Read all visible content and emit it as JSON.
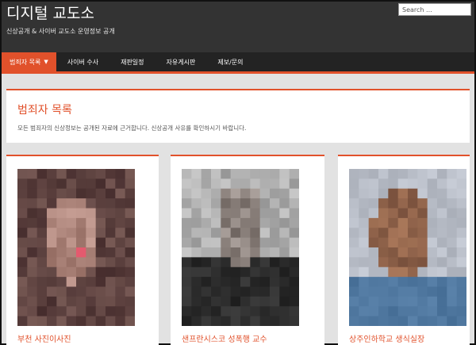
{
  "site": {
    "title": "디지털 교도소",
    "tagline": "신상공개 & 사이버 교도소 운영정보 공개",
    "search_placeholder": "Search ..."
  },
  "nav": {
    "items": [
      {
        "label": "범죄자 목록",
        "active": true,
        "has_dropdown": true
      },
      {
        "label": "사이버 수사",
        "active": false
      },
      {
        "label": "재판일정",
        "active": false
      },
      {
        "label": "자유게시판",
        "active": false
      },
      {
        "label": "제보/문의",
        "active": false
      }
    ]
  },
  "intro": {
    "title": "범죄자 목록",
    "description": "모든 범죄자의 신상정보는 공개된 자료에 근거합니다. 신상공개 사유를 확인하시기 바랍니다."
  },
  "cards": [
    {
      "name": "부천 사진이사진",
      "photo_description": "pixelated"
    },
    {
      "name": "샌프란시스코 성폭행 교수",
      "photo_description": "pixelated"
    },
    {
      "name": "상주인하학교 생식실장",
      "photo_description": "pixelated"
    }
  ],
  "colors": {
    "accent": "#e1512b",
    "header_bg": "#333333",
    "nav_bg": "#232323",
    "page_bg": "#e2e2e2"
  }
}
